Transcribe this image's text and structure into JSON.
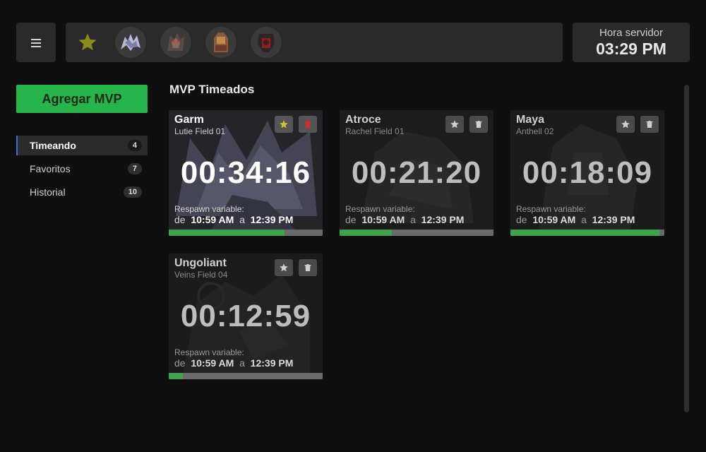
{
  "header": {
    "favorites": [
      {
        "name": "star",
        "icon": "star-icon"
      },
      {
        "name": "avatar-1"
      },
      {
        "name": "avatar-2"
      },
      {
        "name": "avatar-3"
      },
      {
        "name": "avatar-4"
      }
    ],
    "server_time_label": "Hora servidor",
    "server_time": "03:29 PM"
  },
  "sidebar": {
    "add_button": "Agregar MVP",
    "items": [
      {
        "label": "Timeando",
        "count": "4"
      },
      {
        "label": "Favoritos",
        "count": "7"
      },
      {
        "label": "Historial",
        "count": "10"
      }
    ]
  },
  "main": {
    "title": "MVP Timeados",
    "cards": [
      {
        "name": "Garm",
        "map": "Lutie Field 01",
        "timer": "00:34:16",
        "respawn_label": "Respawn variable:",
        "from_word": "de",
        "from": "10:59 AM",
        "to_word": "a",
        "to": "12:39 PM",
        "progress": 0.75,
        "favorite": true
      },
      {
        "name": "Atroce",
        "map": "Rachel Field 01",
        "timer": "00:21:20",
        "respawn_label": "Respawn variable:",
        "from_word": "de",
        "from": "10:59 AM",
        "to_word": "a",
        "to": "12:39 PM",
        "progress": 0.34,
        "favorite": false
      },
      {
        "name": "Maya",
        "map": "Anthell 02",
        "timer": "00:18:09",
        "respawn_label": "Respawn variable:",
        "from_word": "de",
        "from": "10:59 AM",
        "to_word": "a",
        "to": "12:39 PM",
        "progress": 0.97,
        "favorite": false
      },
      {
        "name": "Ungoliant",
        "map": "Veins Field 04",
        "timer": "00:12:59",
        "respawn_label": "Respawn variable:",
        "from_word": "de",
        "from": "10:59 AM",
        "to_word": "a",
        "to": "12:39 PM",
        "progress": 0.09,
        "favorite": false
      }
    ]
  },
  "colors": {
    "accent_green": "#27b54b",
    "progress_green": "#3ea24d",
    "favorite_star": "#b8b82a",
    "delete_red": "#d22b2b",
    "nav_active_border": "#3d6fd9"
  }
}
